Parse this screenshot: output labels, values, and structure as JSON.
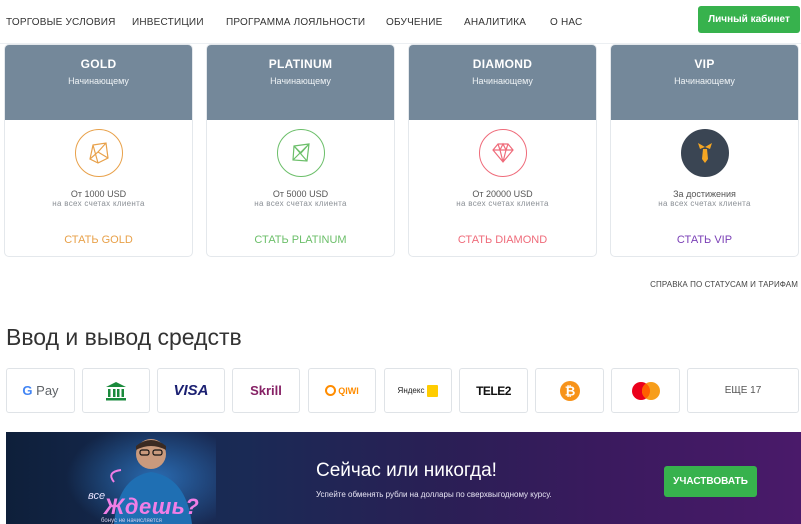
{
  "nav": {
    "items": [
      "ТОРГОВЫЕ УСЛОВИЯ",
      "ИНВЕСТИЦИИ",
      "ПРОГРАММА ЛОЯЛЬНОСТИ",
      "ОБУЧЕНИЕ",
      "АНАЛИТИКА",
      "О НАС"
    ],
    "cabinet": "Личный кабинет"
  },
  "cards": [
    {
      "name": "GOLD",
      "sub": "Начинающему",
      "amount": "От 1000 USD",
      "amount_sub": "на всех счетах клиента",
      "cta": "СТАТЬ GOLD",
      "color": "#e8a14a",
      "icon": "gold-gem-icon"
    },
    {
      "name": "PLATINUM",
      "sub": "Начинающему",
      "amount": "От 5000 USD",
      "amount_sub": "на всех счетах клиента",
      "cta": "СТАТЬ PLATINUM",
      "color": "#6cbf6a",
      "icon": "platinum-gem-icon"
    },
    {
      "name": "DIAMOND",
      "sub": "Начинающему",
      "amount": "От 20000 USD",
      "amount_sub": "на всех счетах клиента",
      "cta": "СТАТЬ DIAMOND",
      "color": "#ef6b7a",
      "icon": "diamond-icon"
    },
    {
      "name": "VIP",
      "sub": "Начинающему",
      "amount": "За достижения",
      "amount_sub": "на всех счетах клиента",
      "cta": "СТАТЬ VIP",
      "color": "#7a3fb6",
      "icon": "vip-tie-icon"
    }
  ],
  "help_link": "СПРАВКА ПО СТАТУСАМ И ТАРИФАМ",
  "section_title": "Ввод и вывод средств",
  "payments": {
    "gpay": "G Pay",
    "visa": "VISA",
    "skrill": "Skrill",
    "qiwi": "QIWI",
    "yandex": "Яндекс",
    "tele2": "TELE2",
    "more": "ЕЩЕ 17"
  },
  "banner": {
    "headline": "Сейчас или никогда!",
    "sub": "Успейте обменять рубли на доллары по сверхвыгодному курсу.",
    "join": "УЧАСТВОВАТЬ",
    "promo_small": "все",
    "promo_big": "Ждешь?",
    "promo_tiny": "бонус не начисляется"
  },
  "colors": {
    "accent": "#37b24d",
    "card_header": "#74889a"
  }
}
